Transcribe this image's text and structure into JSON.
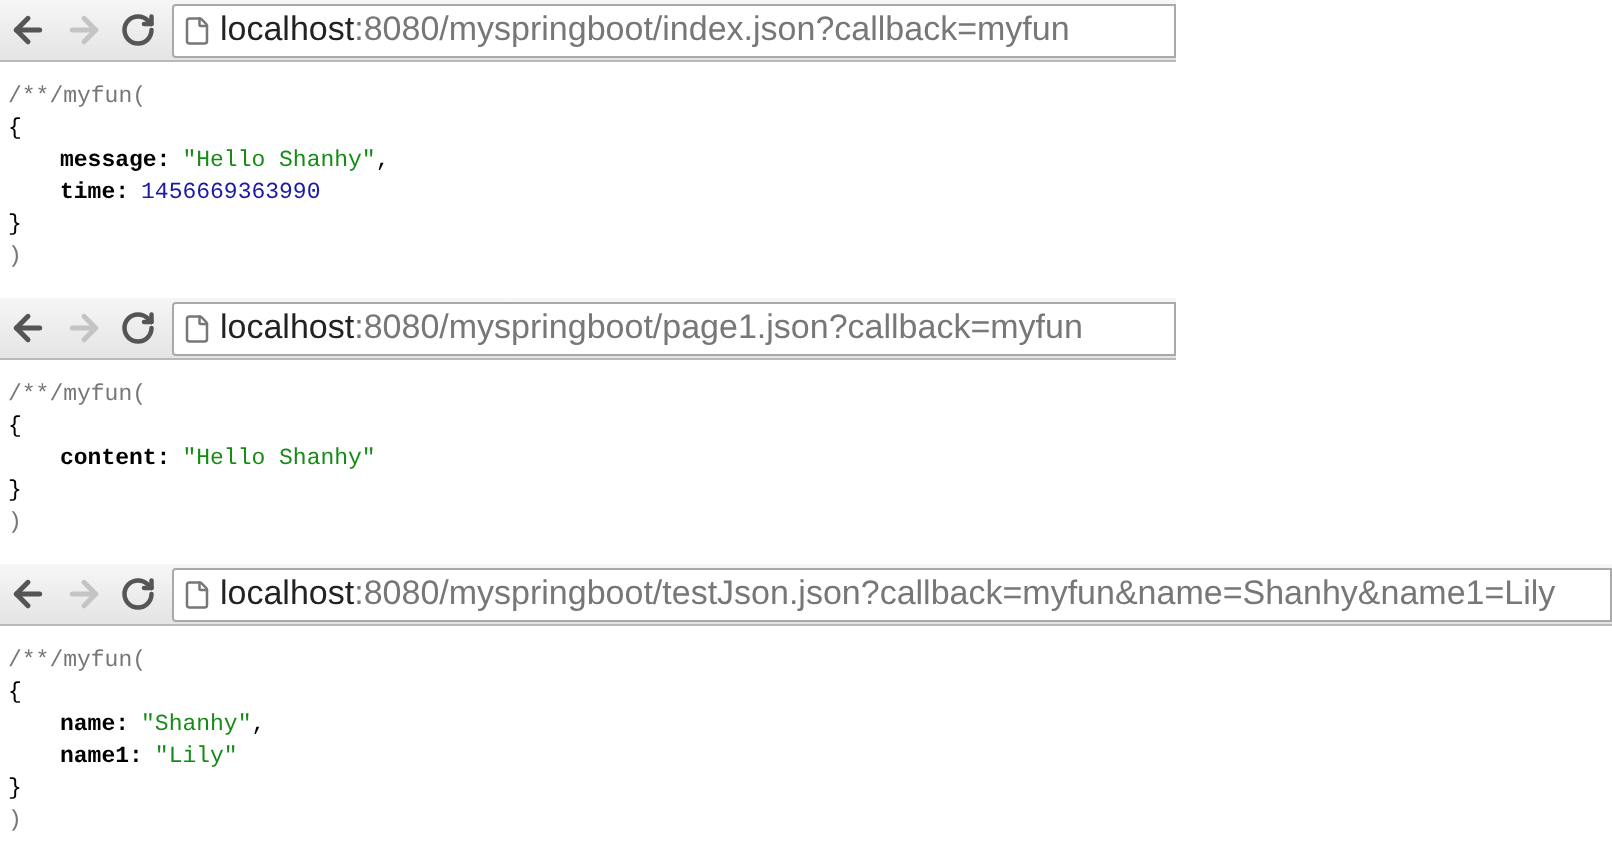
{
  "panels": [
    {
      "back_disabled": false,
      "forward_disabled": true,
      "url_host": "localhost",
      "url_rest": ":8080/myspringboot/index.json?callback=myfun",
      "prefix": "/**/myfun(",
      "open": "{",
      "fields": [
        {
          "key": "message:",
          "value": "\"Hello Shanhy\"",
          "kind": "string",
          "trailing": ","
        },
        {
          "key": "time:",
          "value": "1456669363990",
          "kind": "number"
        }
      ],
      "close": "}",
      "suffix": ")"
    },
    {
      "back_disabled": false,
      "forward_disabled": true,
      "url_host": "localhost",
      "url_rest": ":8080/myspringboot/page1.json?callback=myfun",
      "prefix": "/**/myfun(",
      "open": "{",
      "fields": [
        {
          "key": "content:",
          "value": "\"Hello Shanhy\"",
          "kind": "string"
        }
      ],
      "close": "}",
      "suffix": ")"
    },
    {
      "back_disabled": false,
      "forward_disabled": true,
      "url_host": "localhost",
      "url_rest": ":8080/myspringboot/testJson.json?callback=myfun&name=Shanhy&name1=Lily",
      "prefix": "/**/myfun(",
      "open": "{",
      "fields": [
        {
          "key": "name:",
          "value": "\"Shanhy\"",
          "kind": "string",
          "trailing": ","
        },
        {
          "key": "name1:",
          "value": "\"Lily\"",
          "kind": "string"
        }
      ],
      "close": "}",
      "suffix": ")"
    }
  ]
}
